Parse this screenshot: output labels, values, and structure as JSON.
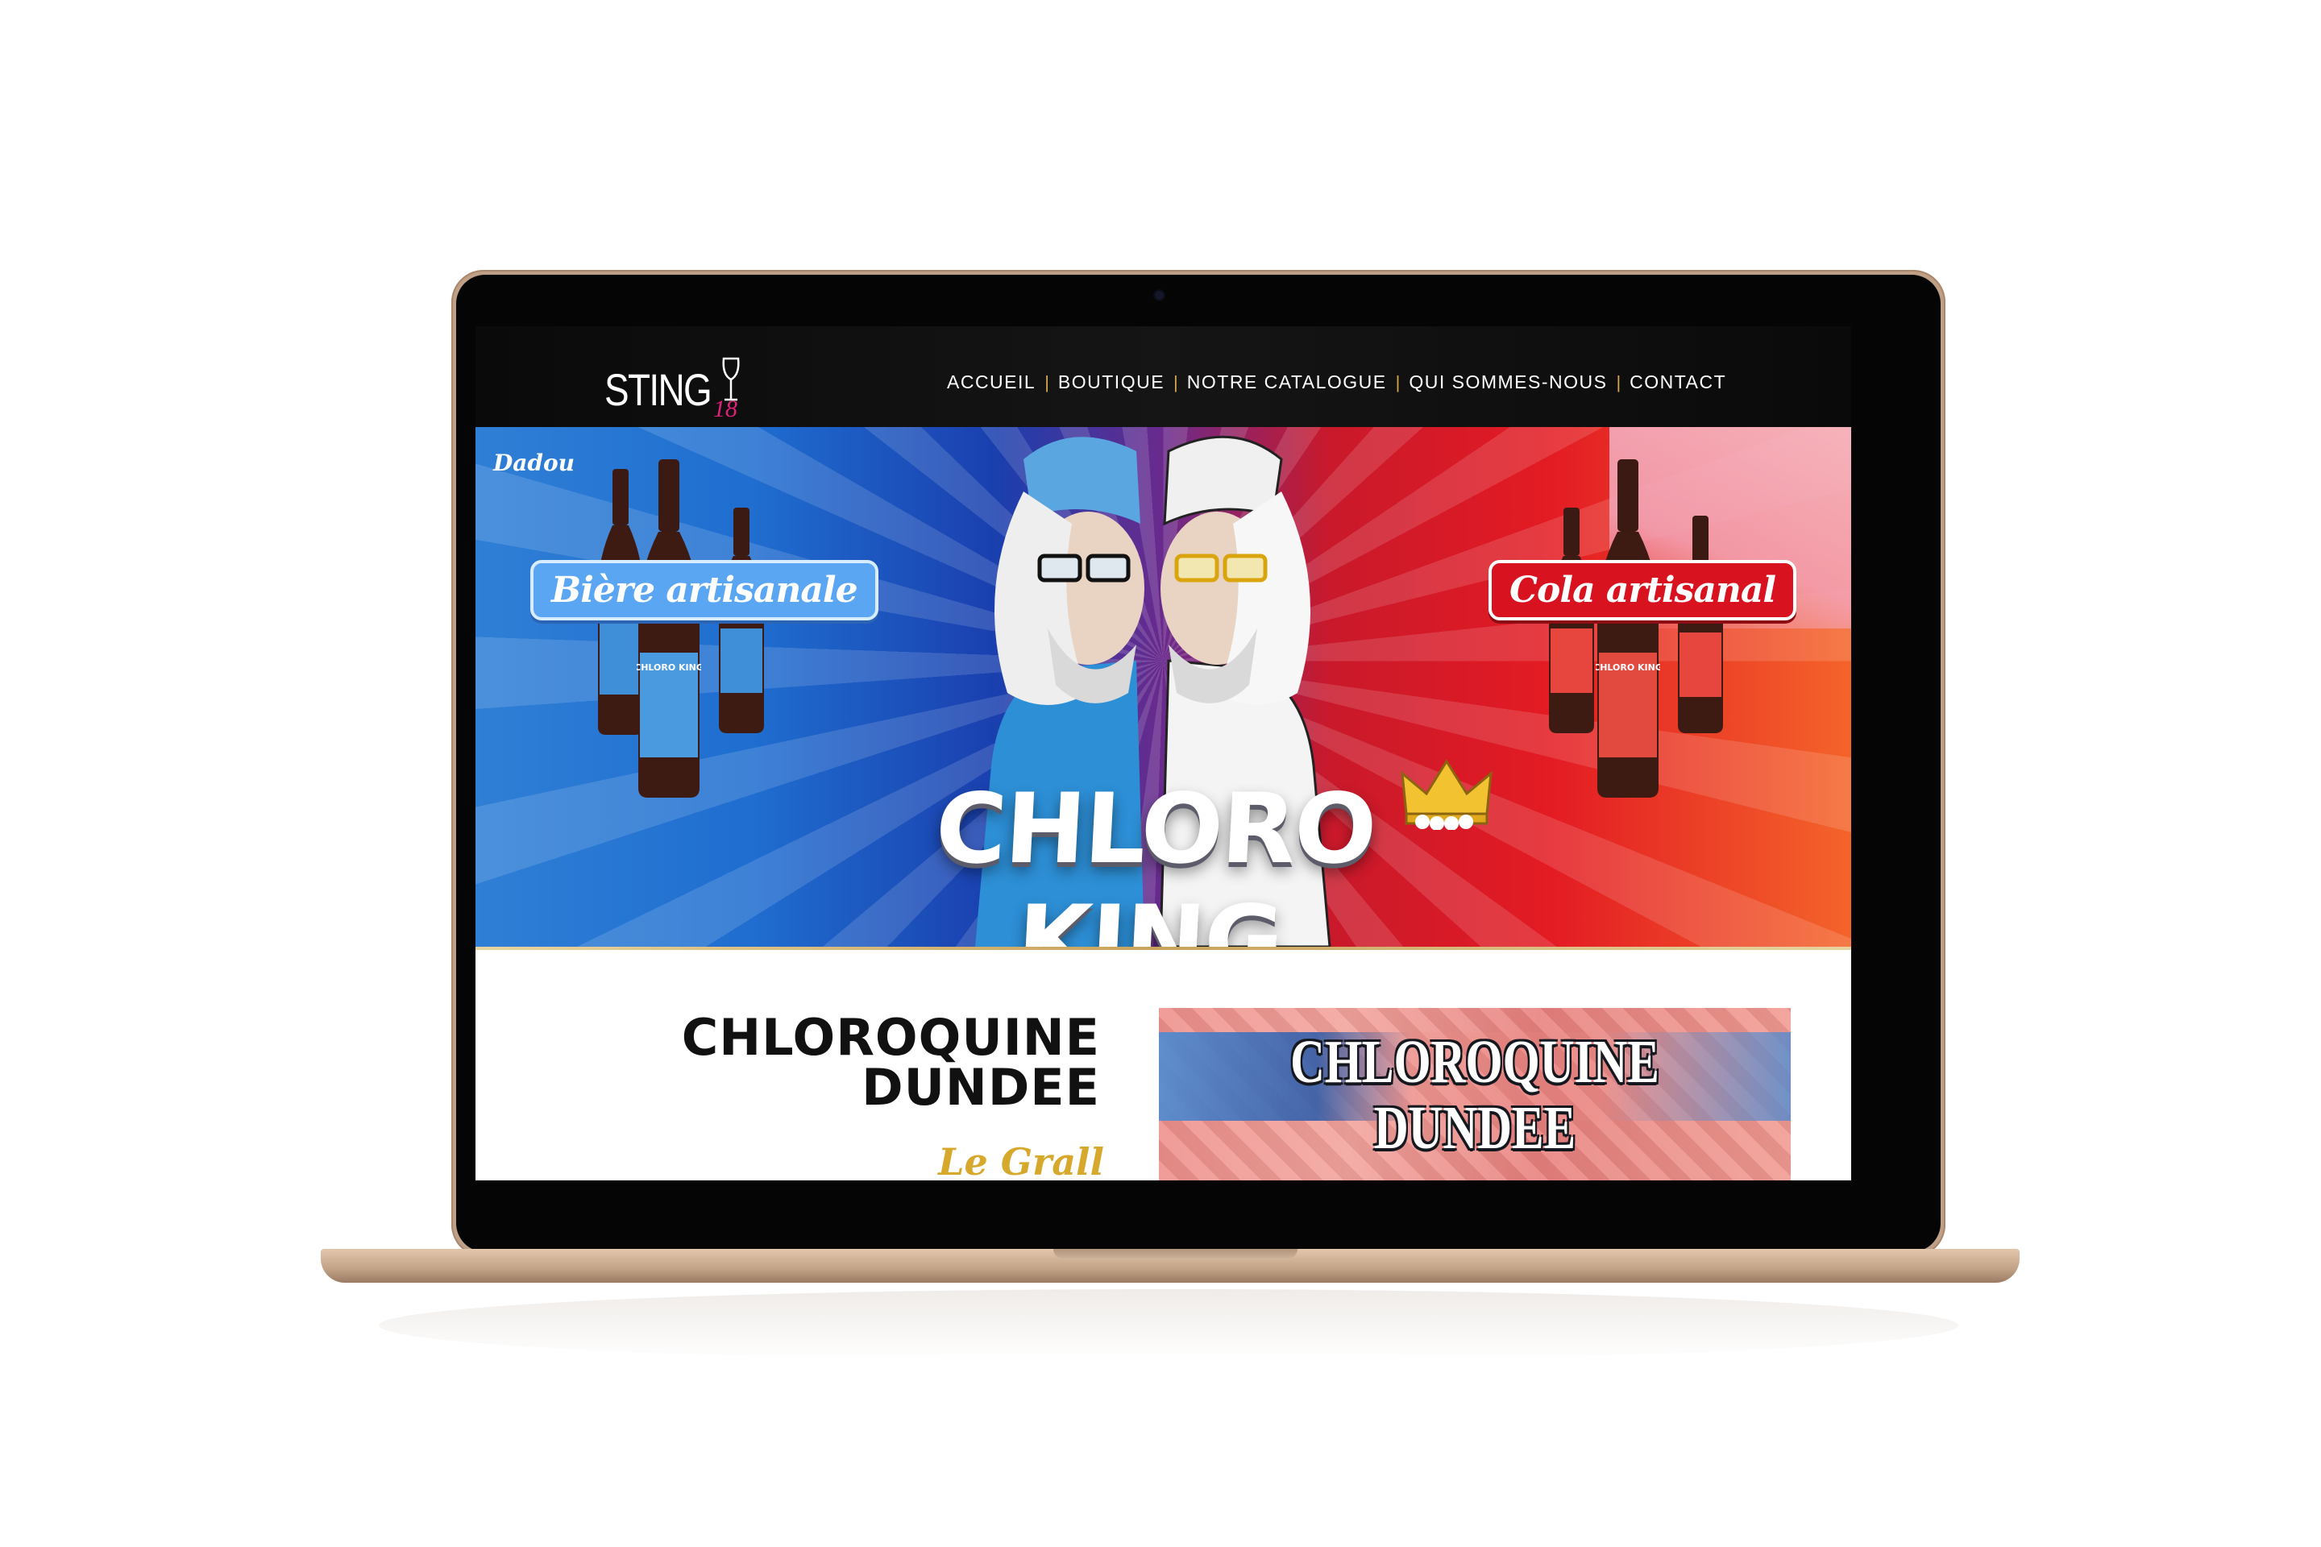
{
  "site": {
    "logo": {
      "name": "STING",
      "sub": "18"
    },
    "nav": [
      {
        "label": "ACCUEIL"
      },
      {
        "label": "BOUTIQUE"
      },
      {
        "label": "NOTRE CATALOGUE"
      },
      {
        "label": "QUI SOMMES-NOUS"
      },
      {
        "label": "CONTACT"
      }
    ]
  },
  "hero": {
    "signature": "Dadou",
    "left_pill": "Bière artisanale",
    "right_pill": "Cola artisanal",
    "title": "CHLORO KING",
    "bottle_label": "CHLORO KING"
  },
  "article": {
    "title_line1": "CHLOROQUINE",
    "title_line2": "DUNDEE",
    "author": "Le Grall Art",
    "image_title_line1": "CHLOROQUINE",
    "image_title_line2": "DUNDEE"
  },
  "colors": {
    "nav_separator": "#d7a84a",
    "logo_accent": "#e0207a",
    "hero_blue": "#1f6ed0",
    "hero_red": "#e31b23",
    "author_gold": "#d6a82c",
    "laptop_body": "#bf9f86"
  }
}
